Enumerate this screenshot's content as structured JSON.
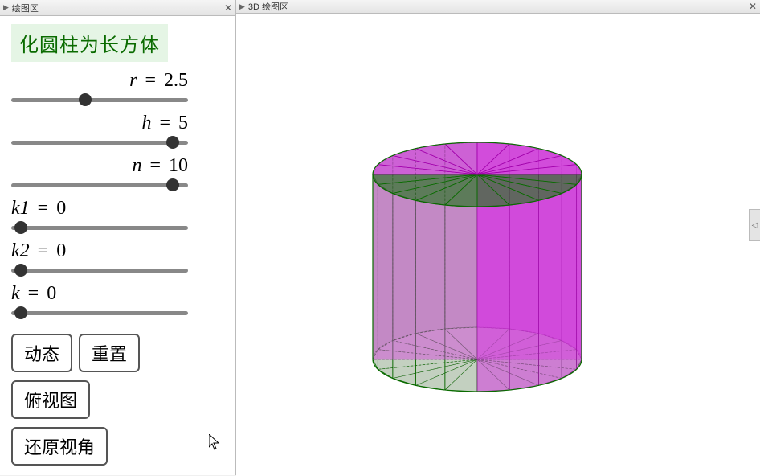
{
  "left_panel": {
    "header": "绘图区",
    "title": "化圆柱为长方体",
    "sliders": [
      {
        "var": "r",
        "display": "r = 2.5",
        "value": 2.5,
        "pos": 0.4,
        "align": "right"
      },
      {
        "var": "h",
        "display": "h = 5",
        "value": 5,
        "pos": 0.92,
        "align": "right"
      },
      {
        "var": "n",
        "display": "n = 10",
        "value": 10,
        "pos": 0.92,
        "align": "right"
      },
      {
        "var": "k1",
        "display": "k1 = 0",
        "value": 0,
        "pos": 0.02,
        "align": "left"
      },
      {
        "var": "k2",
        "display": "k2 = 0",
        "value": 0,
        "pos": 0.02,
        "align": "left"
      },
      {
        "var": "k",
        "display": "k = 0",
        "value": 0,
        "pos": 0.02,
        "align": "left"
      }
    ],
    "buttons": {
      "animate": "动态",
      "reset": "重置",
      "topview": "俯视图",
      "restore": "还原视角"
    }
  },
  "right_panel": {
    "header": "3D 绘图区"
  },
  "cylinder": {
    "radius": 2.5,
    "height": 5,
    "slices": 10,
    "color_front": "#d63be0",
    "color_back": "#0a6b00"
  }
}
